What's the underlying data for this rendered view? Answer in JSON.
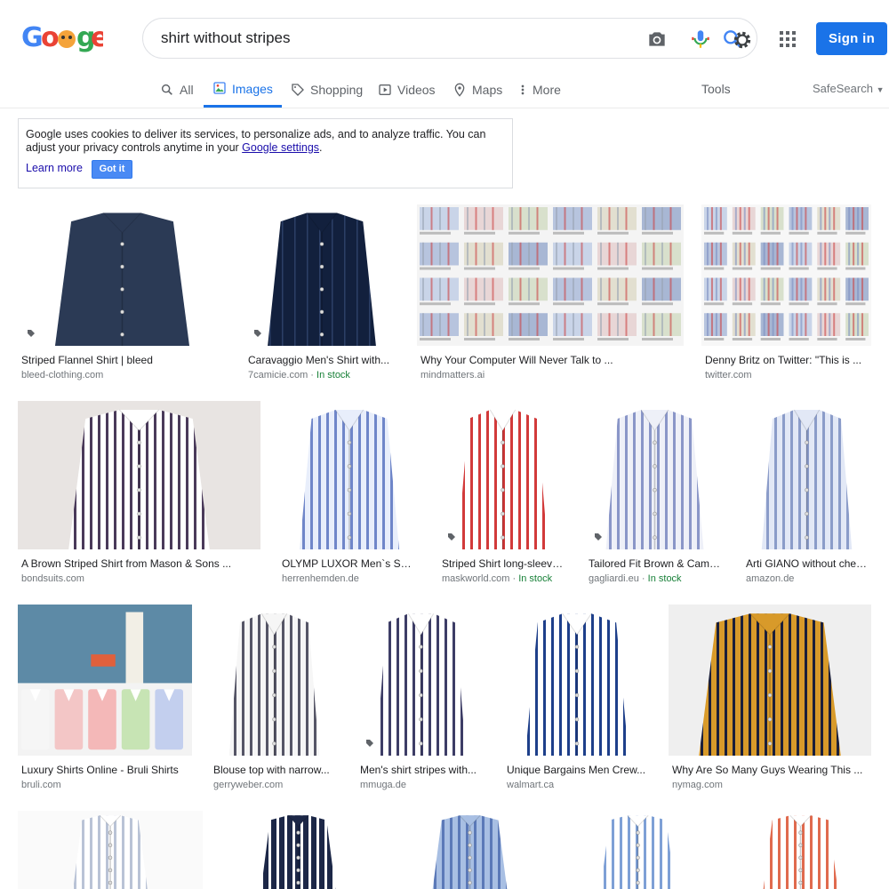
{
  "search": {
    "query": "shirt without stripes"
  },
  "header": {
    "signin_label": "Sign in"
  },
  "tabs": [
    {
      "label": "All",
      "icon": "search-icon"
    },
    {
      "label": "Images",
      "icon": "image-icon"
    },
    {
      "label": "Shopping",
      "icon": "tag-icon"
    },
    {
      "label": "Videos",
      "icon": "play-icon"
    },
    {
      "label": "Maps",
      "icon": "map-pin-icon"
    },
    {
      "label": "More",
      "icon": "more-vert-icon"
    }
  ],
  "tools_label": "Tools",
  "safesearch_label": "SafeSearch",
  "cookie": {
    "text_before": "Google uses cookies to deliver its services, to personalize ads, and to analyze traffic. You can adjust your privacy controls anytime in your ",
    "link": "Google settings",
    "text_after": ".",
    "learn_more": "Learn more",
    "got_it": "Got it"
  },
  "results": [
    {
      "title": "Striped Flannel Shirt | bleed",
      "source": "bleed-clothing.com",
      "stock": ""
    },
    {
      "title": "Caravaggio Men's Shirt with...",
      "source": "7camicie.com",
      "stock": "In stock"
    },
    {
      "title": "Why Your Computer Will Never Talk to ...",
      "source": "mindmatters.ai",
      "stock": ""
    },
    {
      "title": "Denny Britz on Twitter: \"This is ...",
      "source": "twitter.com",
      "stock": ""
    },
    {
      "title": "A Brown Striped Shirt from Mason & Sons ...",
      "source": "bondsuits.com",
      "stock": ""
    },
    {
      "title": "OLYMP LUXOR Men`s Shirt ...",
      "source": "herrenhemden.de",
      "stock": ""
    },
    {
      "title": "Striped Shirt long-sleeve...",
      "source": "maskworld.com",
      "stock": "In stock"
    },
    {
      "title": "Tailored Fit Brown & Camel...",
      "source": "gagliardi.eu",
      "stock": "In stock"
    },
    {
      "title": "Arti GIANO without chest...",
      "source": "amazon.de",
      "stock": ""
    },
    {
      "title": "Luxury Shirts Online - Bruli Shirts",
      "source": "bruli.com",
      "stock": ""
    },
    {
      "title": "Blouse top with narrow...",
      "source": "gerryweber.com",
      "stock": ""
    },
    {
      "title": "Men's shirt stripes with...",
      "source": "mmuga.de",
      "stock": ""
    },
    {
      "title": "Unique Bargains Men Crew...",
      "source": "walmart.ca",
      "stock": ""
    },
    {
      "title": "Why Are So Many Guys Wearing This ...",
      "source": "nymag.com",
      "stock": ""
    },
    {
      "title": "",
      "source": "",
      "stock": ""
    },
    {
      "title": "",
      "source": "",
      "stock": ""
    },
    {
      "title": "",
      "source": "",
      "stock": ""
    },
    {
      "title": "",
      "source": "",
      "stock": ""
    },
    {
      "title": "",
      "source": "",
      "stock": ""
    }
  ],
  "thumbs": [
    {
      "bg": "#ffffff",
      "shirt": "#2b3a55",
      "stripe": "#3d4f6e",
      "stripe_bg": "none",
      "tag": true
    },
    {
      "bg": "#ffffff",
      "shirt": "#12203d",
      "stripe": "#2c3f66",
      "stripe_bg": "dark",
      "tag": true
    },
    {
      "bg": "#f4f4f4",
      "shirt": "#9aa4b3",
      "stripe": "#c44",
      "stripe_bg": "collage",
      "tag": false
    },
    {
      "bg": "#f7f7f7",
      "shirt": "#7c8dbf",
      "stripe": "#c44",
      "stripe_bg": "collage",
      "tag": false
    },
    {
      "bg": "#e8e4e2",
      "shirt": "#ffffff",
      "stripe": "#4a3a5a",
      "stripe_bg": "stripes",
      "tag": false
    },
    {
      "bg": "#ffffff",
      "shirt": "#e8eefb",
      "stripe": "#6f86c9",
      "stripe_bg": "stripes",
      "tag": false
    },
    {
      "bg": "#ffffff",
      "shirt": "#ffffff",
      "stripe": "#d23a3a",
      "stripe_bg": "stripes",
      "tag": true
    },
    {
      "bg": "#ffffff",
      "shirt": "#eef0f8",
      "stripe": "#8a96c8",
      "stripe_bg": "stripes",
      "tag": true
    },
    {
      "bg": "#ffffff",
      "shirt": "#e2e8f6",
      "stripe": "#8b9cc9",
      "stripe_bg": "stripes",
      "tag": false
    },
    {
      "bg": "#5d8aa6",
      "shirt": "#ffffff",
      "stripe": "#d95c5c",
      "stripe_bg": "bruli",
      "tag": false
    },
    {
      "bg": "#ffffff",
      "shirt": "#f6f6f6",
      "stripe": "#555566",
      "stripe_bg": "stripes",
      "tag": false
    },
    {
      "bg": "#ffffff",
      "shirt": "#ffffff",
      "stripe": "#3d3d66",
      "stripe_bg": "stripes",
      "tag": true
    },
    {
      "bg": "#ffffff",
      "shirt": "#ffffff",
      "stripe": "#1e3f8a",
      "stripe_bg": "stripes",
      "tag": false
    },
    {
      "bg": "#efefef",
      "shirt": "#d89a2a",
      "stripe": "#1b1f3a",
      "stripe_bg": "stripes",
      "tag": false
    },
    {
      "bg": "#fafafa",
      "shirt": "#ffffff",
      "stripe": "#b9c3d6",
      "stripe_bg": "stripes",
      "tag": false
    },
    {
      "bg": "#ffffff",
      "shirt": "#1c2747",
      "stripe": "#ffffff",
      "stripe_bg": "stripes",
      "tag": false
    },
    {
      "bg": "#ffffff",
      "shirt": "#a8bfe3",
      "stripe": "#5b79b8",
      "stripe_bg": "stripes",
      "tag": false
    },
    {
      "bg": "#ffffff",
      "shirt": "#ffffff",
      "stripe": "#7ea0d6",
      "stripe_bg": "stripes",
      "tag": false
    },
    {
      "bg": "#ffffff",
      "shirt": "#ffffff",
      "stripe": "#e06a4e",
      "stripe_bg": "stripes",
      "tag": false
    }
  ],
  "colors": {
    "accent": "#1a73e8",
    "link": "#1a0dab",
    "stock": "#188038"
  }
}
